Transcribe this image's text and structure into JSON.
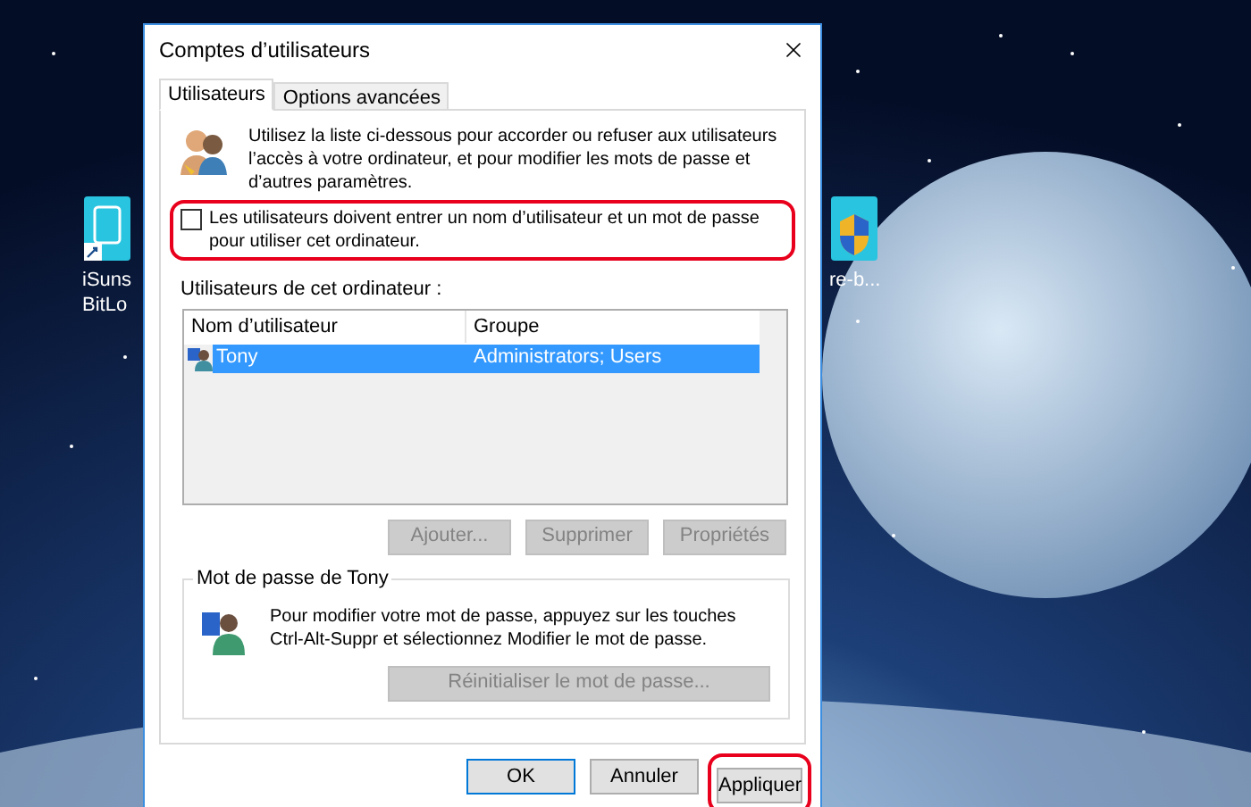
{
  "desktop_icons": [
    {
      "label_lines": [
        "iSuns",
        "BitLo"
      ],
      "kind": "drive"
    },
    {
      "label_lines": [
        "re-b..."
      ],
      "kind": "shield"
    }
  ],
  "dialog": {
    "title": "Comptes d’utilisateurs",
    "tabs": [
      {
        "label": "Utilisateurs",
        "selected": true
      },
      {
        "label": "Options avancées",
        "selected": false
      }
    ],
    "intro": "Utilisez la liste ci-dessous pour accorder ou refuser aux utilisateurs l’accès à votre ordinateur, et pour modifier les mots de passe et d’autres paramètres.",
    "require_login": {
      "label": "Les utilisateurs doivent entrer un nom d’utilisateur et un mot de passe pour utiliser cet ordinateur.",
      "checked": false,
      "highlighted": true
    },
    "users_label": "Utilisateurs de cet ordinateur :",
    "columns": [
      "Nom d’utilisateur",
      "Groupe"
    ],
    "rows": [
      {
        "name": "Tony",
        "group": "Administrators; Users",
        "selected": true
      }
    ],
    "list_buttons": [
      {
        "label": "Ajouter...",
        "disabled": true
      },
      {
        "label": "Supprimer",
        "disabled": true
      },
      {
        "label": "Propriétés",
        "disabled": true
      }
    ],
    "password_group": {
      "title": "Mot de passe de Tony",
      "text": "Pour modifier votre mot de passe, appuyez sur les touches Ctrl-Alt-Suppr et sélectionnez Modifier le mot de passe.",
      "button": {
        "label": "Réinitialiser le mot de passe...",
        "disabled": true
      }
    },
    "footer_buttons": [
      {
        "label": "OK",
        "default": true,
        "highlighted": false
      },
      {
        "label": "Annuler",
        "default": false,
        "highlighted": false
      },
      {
        "label": "Appliquer",
        "default": false,
        "highlighted": true
      }
    ]
  }
}
